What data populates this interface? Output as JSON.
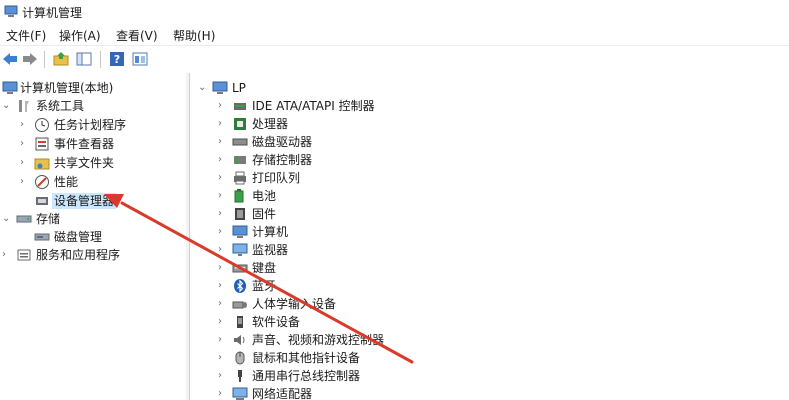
{
  "window": {
    "title": "计算机管理"
  },
  "menu": [
    "文件(F)",
    "操作(A)",
    "查看(V)",
    "帮助(H)"
  ],
  "toolbar": {
    "icons": [
      "back-arrow-icon",
      "forward-arrow-icon",
      "up-folder-icon",
      "show-hide-tree-icon",
      "help-icon",
      "properties-icon"
    ]
  },
  "left_tree": {
    "root": "计算机管理(本地)",
    "system_tools": "系统工具",
    "system_items": [
      "任务计划程序",
      "事件查看器",
      "共享文件夹",
      "性能",
      "设备管理器"
    ],
    "storage": "存储",
    "storage_items": [
      "磁盘管理"
    ],
    "services": "服务和应用程序"
  },
  "right_tree": {
    "root": "LP",
    "devices": [
      "IDE ATA/ATAPI 控制器",
      "处理器",
      "磁盘驱动器",
      "存储控制器",
      "打印队列",
      "电池",
      "固件",
      "计算机",
      "监视器",
      "键盘",
      "蓝牙",
      "人体学输入设备",
      "软件设备",
      "声音、视频和游戏控制器",
      "鼠标和其他指针设备",
      "通用串行总线控制器",
      "网络适配器"
    ]
  },
  "colors": {
    "selection": "#cce8ff",
    "annotation_arrow": "#d93a2b"
  }
}
